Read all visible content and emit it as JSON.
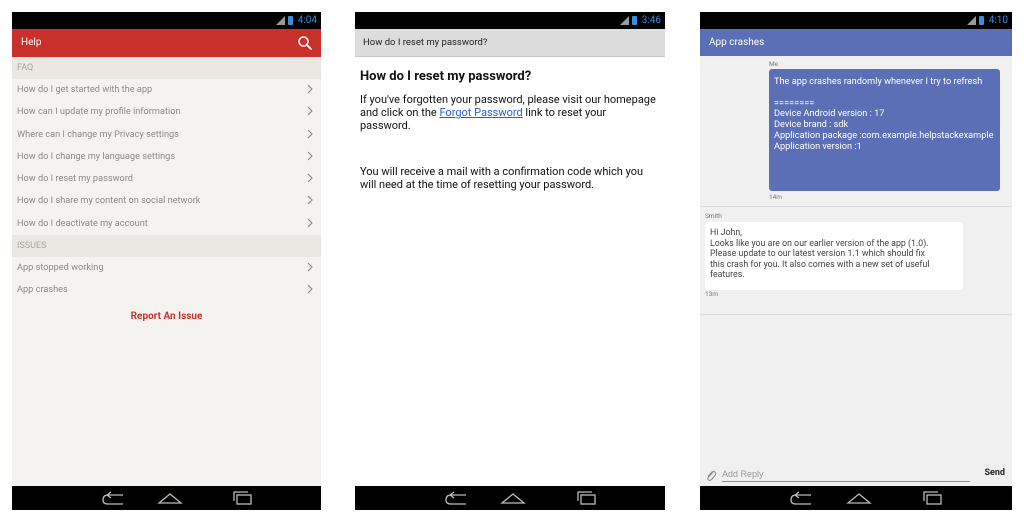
{
  "panel1": {
    "time": "4:04",
    "header_title": "Help",
    "faq_label": "FAQ",
    "faq_items": [
      "How do I get started with the app",
      "How can I update my profile information",
      "Where can I change my Privacy settings",
      "How do I change my language settings",
      "How do I reset my password",
      "How do I share my content on social network",
      "How do I deactivate my account"
    ],
    "issues_label": "ISSUES",
    "issue_items": [
      "App stopped working",
      "App crashes"
    ],
    "report_button": "Report An Issue",
    "accent_color": "#c9302c"
  },
  "panel2": {
    "time": "3:46",
    "header_title": "How do I reset my password?",
    "article_title": "How do I reset my password?",
    "para1_before": "If you've forgotten your password, please visit our homepage and click on the ",
    "para1_link": "Forgot Password",
    "para1_after": " link to reset your password.",
    "para2": "You will receive a mail with a confirmation code which you will need at the time of resetting your password."
  },
  "panel3": {
    "time": "4:10",
    "header_title": "App crashes",
    "me_label": "Me",
    "me_message": "The app crashes randomly whenever I try to refresh\n\n========\nDevice Android version : 17\nDevice brand : sdk\nApplication package :com.example.helpstackexample\nApplication version :1",
    "me_time": "14m",
    "smith_label": "Smith",
    "smith_message": "Hi John,\nLooks like you are on our earlier version of the app (1.0).\nPlease update to our latest version 1.1 which should fix\nthis crash for you. It also comes with a new set of useful\nfeatures.",
    "smith_time": "13m",
    "reply_placeholder": "Add Reply",
    "send_label": "Send",
    "accent_color": "#5a6fb5"
  }
}
